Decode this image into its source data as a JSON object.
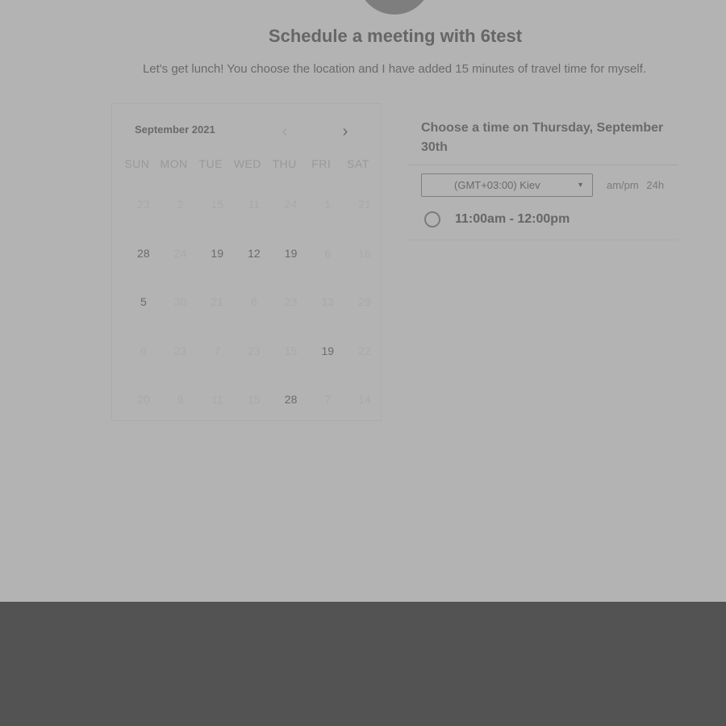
{
  "header": {
    "title": "Schedule a meeting with 6test",
    "description": "Let's get lunch! You choose the location and I have added 15 minutes of travel time for myself."
  },
  "calendar": {
    "month_label": "September 2021",
    "prev_icon": "chevron-left-icon",
    "next_icon": "chevron-right-icon",
    "weekdays": [
      "SUN",
      "MON",
      "TUE",
      "WED",
      "THU",
      "FRI",
      "SAT"
    ],
    "weeks": [
      [
        {
          "d": "23",
          "a": false
        },
        {
          "d": "2",
          "a": false
        },
        {
          "d": "15",
          "a": false
        },
        {
          "d": "11",
          "a": false
        },
        {
          "d": "24",
          "a": false
        },
        {
          "d": "1",
          "a": false
        },
        {
          "d": "21",
          "a": false
        }
      ],
      [
        {
          "d": "28",
          "a": true
        },
        {
          "d": "24",
          "a": false
        },
        {
          "d": "19",
          "a": true
        },
        {
          "d": "12",
          "a": true
        },
        {
          "d": "19",
          "a": true
        },
        {
          "d": "6",
          "a": false
        },
        {
          "d": "16",
          "a": false
        }
      ],
      [
        {
          "d": "5",
          "a": true
        },
        {
          "d": "30",
          "a": false
        },
        {
          "d": "21",
          "a": false
        },
        {
          "d": "6",
          "a": false
        },
        {
          "d": "23",
          "a": false
        },
        {
          "d": "13",
          "a": false
        },
        {
          "d": "29",
          "a": false
        }
      ],
      [
        {
          "d": "6",
          "a": false
        },
        {
          "d": "23",
          "a": false
        },
        {
          "d": "7",
          "a": false
        },
        {
          "d": "23",
          "a": false
        },
        {
          "d": "15",
          "a": false
        },
        {
          "d": "19",
          "a": true
        },
        {
          "d": "22",
          "a": false
        }
      ],
      [
        {
          "d": "20",
          "a": false
        },
        {
          "d": "9",
          "a": false
        },
        {
          "d": "11",
          "a": false
        },
        {
          "d": "15",
          "a": false
        },
        {
          "d": "28",
          "a": true
        },
        {
          "d": "7",
          "a": false
        },
        {
          "d": "14",
          "a": false
        }
      ]
    ]
  },
  "time_picker": {
    "heading": "Choose a time on Thursday, September 30th",
    "timezone_value": "(GMT+03:00) Kiev",
    "format_ampm": "am/pm",
    "format_24h": "24h",
    "slots": [
      {
        "label": "11:00am - 12:00pm"
      }
    ]
  }
}
